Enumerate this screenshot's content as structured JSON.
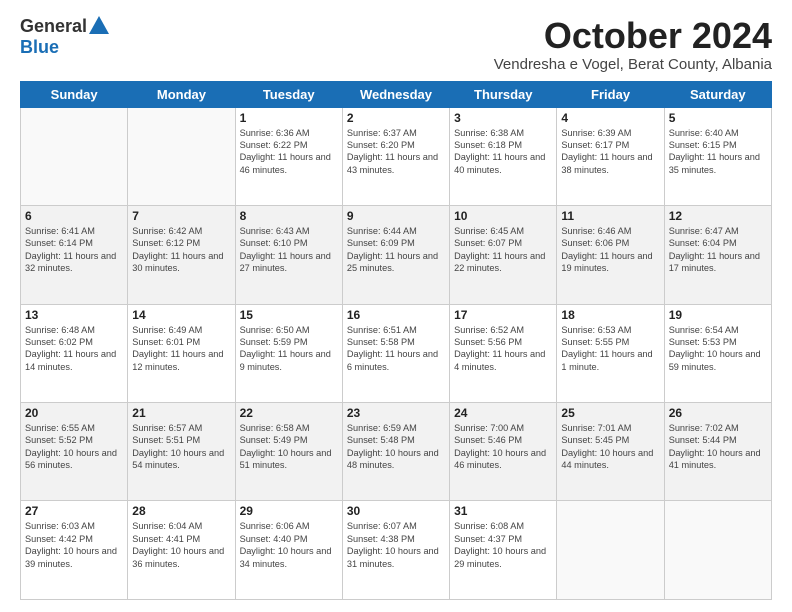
{
  "header": {
    "logo_general": "General",
    "logo_blue": "Blue",
    "month_title": "October 2024",
    "subtitle": "Vendresha e Vogel, Berat County, Albania"
  },
  "days_of_week": [
    "Sunday",
    "Monday",
    "Tuesday",
    "Wednesday",
    "Thursday",
    "Friday",
    "Saturday"
  ],
  "weeks": [
    [
      {
        "day": "",
        "info": ""
      },
      {
        "day": "",
        "info": ""
      },
      {
        "day": "1",
        "info": "Sunrise: 6:36 AM\nSunset: 6:22 PM\nDaylight: 11 hours and 46 minutes."
      },
      {
        "day": "2",
        "info": "Sunrise: 6:37 AM\nSunset: 6:20 PM\nDaylight: 11 hours and 43 minutes."
      },
      {
        "day": "3",
        "info": "Sunrise: 6:38 AM\nSunset: 6:18 PM\nDaylight: 11 hours and 40 minutes."
      },
      {
        "day": "4",
        "info": "Sunrise: 6:39 AM\nSunset: 6:17 PM\nDaylight: 11 hours and 38 minutes."
      },
      {
        "day": "5",
        "info": "Sunrise: 6:40 AM\nSunset: 6:15 PM\nDaylight: 11 hours and 35 minutes."
      }
    ],
    [
      {
        "day": "6",
        "info": "Sunrise: 6:41 AM\nSunset: 6:14 PM\nDaylight: 11 hours and 32 minutes."
      },
      {
        "day": "7",
        "info": "Sunrise: 6:42 AM\nSunset: 6:12 PM\nDaylight: 11 hours and 30 minutes."
      },
      {
        "day": "8",
        "info": "Sunrise: 6:43 AM\nSunset: 6:10 PM\nDaylight: 11 hours and 27 minutes."
      },
      {
        "day": "9",
        "info": "Sunrise: 6:44 AM\nSunset: 6:09 PM\nDaylight: 11 hours and 25 minutes."
      },
      {
        "day": "10",
        "info": "Sunrise: 6:45 AM\nSunset: 6:07 PM\nDaylight: 11 hours and 22 minutes."
      },
      {
        "day": "11",
        "info": "Sunrise: 6:46 AM\nSunset: 6:06 PM\nDaylight: 11 hours and 19 minutes."
      },
      {
        "day": "12",
        "info": "Sunrise: 6:47 AM\nSunset: 6:04 PM\nDaylight: 11 hours and 17 minutes."
      }
    ],
    [
      {
        "day": "13",
        "info": "Sunrise: 6:48 AM\nSunset: 6:02 PM\nDaylight: 11 hours and 14 minutes."
      },
      {
        "day": "14",
        "info": "Sunrise: 6:49 AM\nSunset: 6:01 PM\nDaylight: 11 hours and 12 minutes."
      },
      {
        "day": "15",
        "info": "Sunrise: 6:50 AM\nSunset: 5:59 PM\nDaylight: 11 hours and 9 minutes."
      },
      {
        "day": "16",
        "info": "Sunrise: 6:51 AM\nSunset: 5:58 PM\nDaylight: 11 hours and 6 minutes."
      },
      {
        "day": "17",
        "info": "Sunrise: 6:52 AM\nSunset: 5:56 PM\nDaylight: 11 hours and 4 minutes."
      },
      {
        "day": "18",
        "info": "Sunrise: 6:53 AM\nSunset: 5:55 PM\nDaylight: 11 hours and 1 minute."
      },
      {
        "day": "19",
        "info": "Sunrise: 6:54 AM\nSunset: 5:53 PM\nDaylight: 10 hours and 59 minutes."
      }
    ],
    [
      {
        "day": "20",
        "info": "Sunrise: 6:55 AM\nSunset: 5:52 PM\nDaylight: 10 hours and 56 minutes."
      },
      {
        "day": "21",
        "info": "Sunrise: 6:57 AM\nSunset: 5:51 PM\nDaylight: 10 hours and 54 minutes."
      },
      {
        "day": "22",
        "info": "Sunrise: 6:58 AM\nSunset: 5:49 PM\nDaylight: 10 hours and 51 minutes."
      },
      {
        "day": "23",
        "info": "Sunrise: 6:59 AM\nSunset: 5:48 PM\nDaylight: 10 hours and 48 minutes."
      },
      {
        "day": "24",
        "info": "Sunrise: 7:00 AM\nSunset: 5:46 PM\nDaylight: 10 hours and 46 minutes."
      },
      {
        "day": "25",
        "info": "Sunrise: 7:01 AM\nSunset: 5:45 PM\nDaylight: 10 hours and 44 minutes."
      },
      {
        "day": "26",
        "info": "Sunrise: 7:02 AM\nSunset: 5:44 PM\nDaylight: 10 hours and 41 minutes."
      }
    ],
    [
      {
        "day": "27",
        "info": "Sunrise: 6:03 AM\nSunset: 4:42 PM\nDaylight: 10 hours and 39 minutes."
      },
      {
        "day": "28",
        "info": "Sunrise: 6:04 AM\nSunset: 4:41 PM\nDaylight: 10 hours and 36 minutes."
      },
      {
        "day": "29",
        "info": "Sunrise: 6:06 AM\nSunset: 4:40 PM\nDaylight: 10 hours and 34 minutes."
      },
      {
        "day": "30",
        "info": "Sunrise: 6:07 AM\nSunset: 4:38 PM\nDaylight: 10 hours and 31 minutes."
      },
      {
        "day": "31",
        "info": "Sunrise: 6:08 AM\nSunset: 4:37 PM\nDaylight: 10 hours and 29 minutes."
      },
      {
        "day": "",
        "info": ""
      },
      {
        "day": "",
        "info": ""
      }
    ]
  ]
}
